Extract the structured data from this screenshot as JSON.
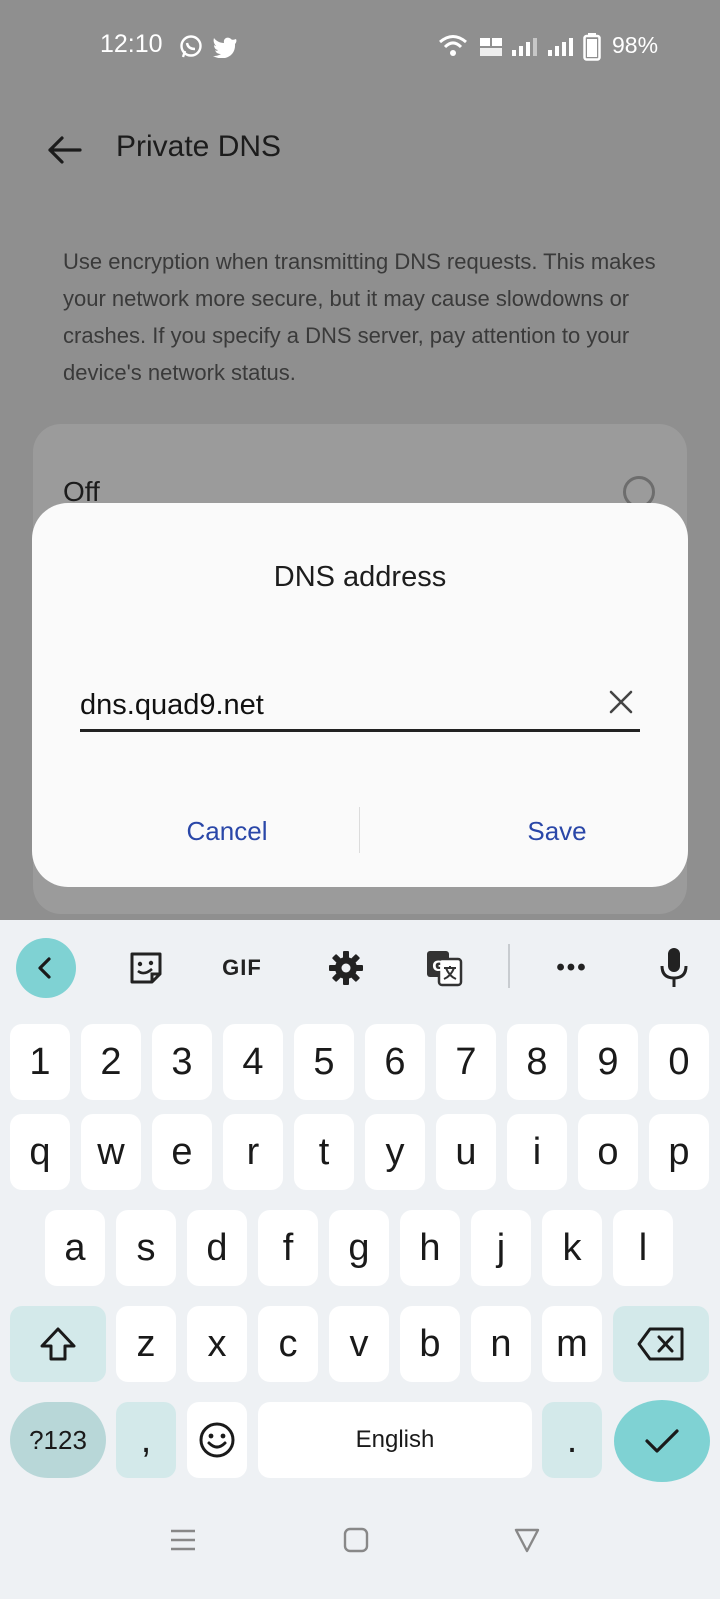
{
  "status_bar": {
    "time": "12:10",
    "battery": "98%"
  },
  "header": {
    "title": "Private DNS"
  },
  "description": "Use encryption when transmitting DNS requests. This makes your network more secure, but it may cause slowdowns or crashes. If you specify a DNS server, pay attention to your device's network status.",
  "options": [
    {
      "label": "Off",
      "selected": false
    }
  ],
  "dialog": {
    "title": "DNS address",
    "input_value": "dns.quad9.net",
    "cancel_label": "Cancel",
    "save_label": "Save"
  },
  "keyboard": {
    "toolbar": {
      "gif_label": "GIF",
      "more_label": "•••"
    },
    "row_numbers": [
      "1",
      "2",
      "3",
      "4",
      "5",
      "6",
      "7",
      "8",
      "9",
      "0"
    ],
    "row_q": [
      "q",
      "w",
      "e",
      "r",
      "t",
      "y",
      "u",
      "i",
      "o",
      "p"
    ],
    "row_a": [
      "a",
      "s",
      "d",
      "f",
      "g",
      "h",
      "j",
      "k",
      "l"
    ],
    "row_z": [
      "z",
      "x",
      "c",
      "v",
      "b",
      "n",
      "m"
    ],
    "bottom": {
      "symbols": "?123",
      "comma": ",",
      "space": "English",
      "period": "."
    }
  },
  "colors": {
    "accent": "#2a47a8",
    "keyboard_teal": "#7fd2d3"
  }
}
